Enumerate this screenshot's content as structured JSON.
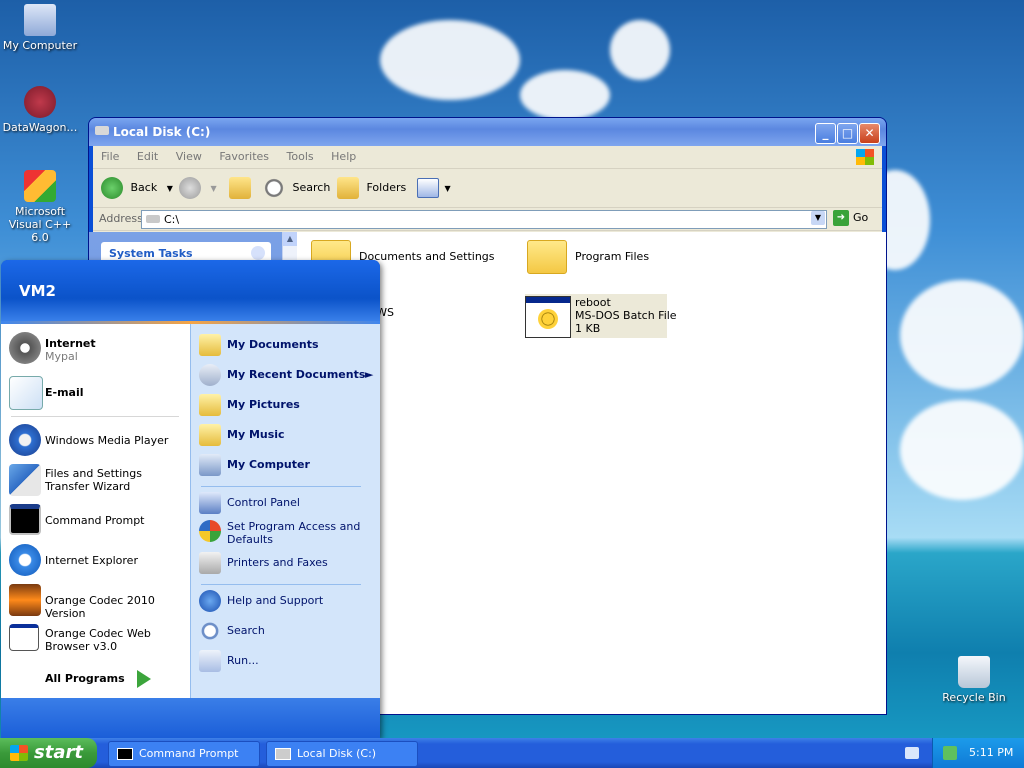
{
  "desktop": {
    "icons": [
      {
        "label": "My Computer",
        "icon": "my-computer-icon"
      },
      {
        "label": "DataWagon…",
        "icon": "datawagon-shortcut-icon"
      },
      {
        "label": "Microsoft Visual C++ 6.0",
        "icon": "visual-cpp-icon"
      },
      {
        "label": "Recycle Bin",
        "icon": "recycle-bin-icon"
      }
    ]
  },
  "explorer": {
    "title": "Local Disk (C:)",
    "menu": [
      "File",
      "Edit",
      "View",
      "Favorites",
      "Tools",
      "Help"
    ],
    "toolbar": {
      "back": "Back",
      "search": "Search",
      "folders": "Folders"
    },
    "address": {
      "label": "Address",
      "value": "C:\\",
      "go": "Go"
    },
    "left_pane": {
      "system_tasks": "System Tasks"
    },
    "files": [
      {
        "name": "Documents and Settings",
        "type": "folder"
      },
      {
        "name": "Program Files",
        "type": "folder"
      },
      {
        "name": "DOWS",
        "type": "folder"
      },
      {
        "name": "reboot",
        "line2": "MS-DOS Batch File",
        "line3": "1 KB",
        "type": "batch"
      }
    ]
  },
  "start_menu": {
    "user": "VM2",
    "pinned": [
      {
        "title": "Internet",
        "subtitle": "Mypal",
        "icon": "raccoon-browser-icon"
      },
      {
        "title": "E-mail",
        "subtitle": "",
        "icon": "email-icon"
      }
    ],
    "recent": [
      {
        "label": "Windows Media Player",
        "icon": "media-player-icon"
      },
      {
        "label": "Files and Settings Transfer Wizard",
        "icon": "transfer-wizard-icon"
      },
      {
        "label": "Command Prompt",
        "icon": "command-prompt-icon"
      },
      {
        "label": "Internet Explorer",
        "icon": "internet-explorer-icon"
      },
      {
        "label": "Orange Codec 2010 Version",
        "icon": "orange-codec-icon"
      },
      {
        "label": "Orange Codec Web Browser v3.0",
        "icon": "web-browser-icon"
      }
    ],
    "all_programs": "All Programs",
    "right_top": [
      {
        "label": "My Documents",
        "icon": "folder-docs-icon"
      },
      {
        "label": "My Recent Documents",
        "icon": "recent-docs-icon"
      },
      {
        "label": "My Pictures",
        "icon": "folder-pictures-icon"
      },
      {
        "label": "My Music",
        "icon": "folder-music-icon"
      },
      {
        "label": "My Computer",
        "icon": "computer-icon"
      }
    ],
    "right_mid": [
      {
        "label": "Control Panel",
        "icon": "control-panel-icon"
      },
      {
        "label": "Set Program Access and Defaults",
        "icon": "program-access-icon"
      },
      {
        "label": "Printers and Faxes",
        "icon": "printer-icon"
      }
    ],
    "right_bottom": [
      {
        "label": "Help and Support",
        "icon": "help-icon"
      },
      {
        "label": "Search",
        "icon": "search-icon"
      },
      {
        "label": "Run...",
        "icon": "run-icon"
      }
    ]
  },
  "taskbar": {
    "start": "start",
    "tasks": [
      {
        "label": "Command Prompt",
        "icon": "command-prompt-icon"
      },
      {
        "label": "Local Disk (C:)",
        "icon": "drive-icon"
      }
    ],
    "clock": "5:11 PM"
  }
}
